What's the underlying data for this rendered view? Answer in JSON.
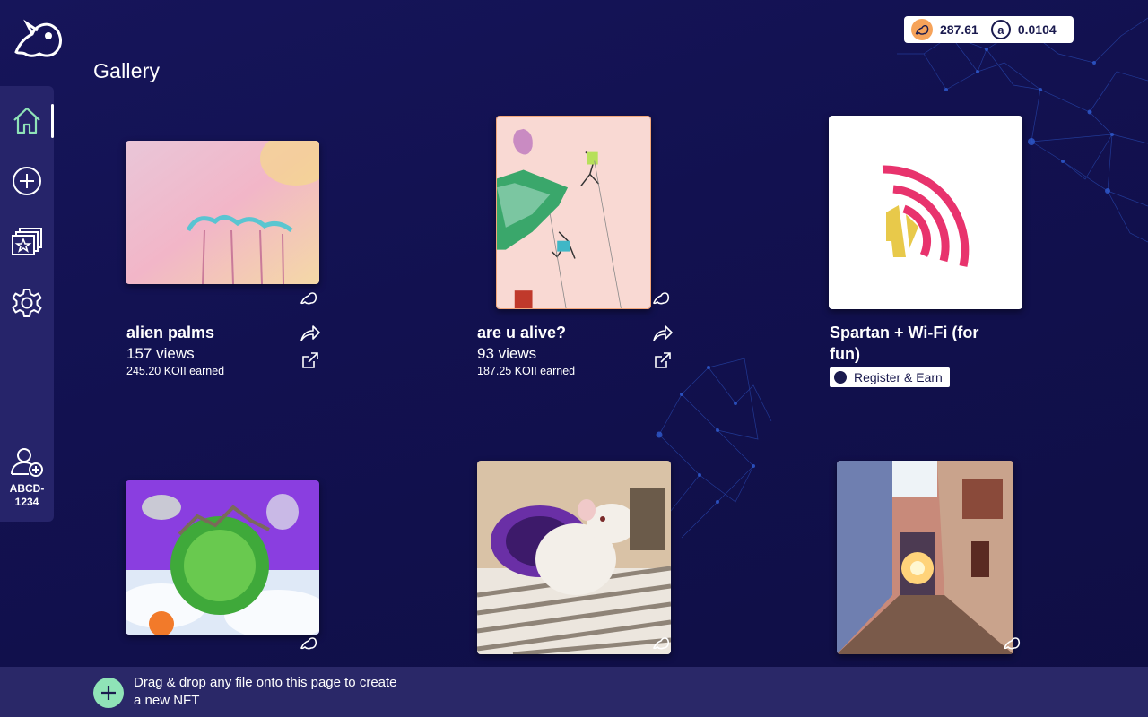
{
  "app": {
    "logo_icon": "koii-logo-icon"
  },
  "balance": {
    "koii_value": "287.61",
    "ar_symbol": "a",
    "ar_value": "0.0104"
  },
  "page": {
    "title": "Gallery"
  },
  "sidebar": {
    "items": [
      {
        "name": "home",
        "icon": "home-icon",
        "active": true
      },
      {
        "name": "create",
        "icon": "plus-circle-icon"
      },
      {
        "name": "collections",
        "icon": "collection-star-icon"
      },
      {
        "name": "settings",
        "icon": "gear-icon"
      }
    ],
    "account": {
      "icon": "add-user-icon",
      "id": "ABCD-\n1234"
    }
  },
  "gallery": {
    "items": [
      {
        "title": "alien palms",
        "views": "157 views",
        "earned": "245.20 KOII earned"
      },
      {
        "title": "are u alive?",
        "views": "93 views",
        "earned": "187.25 KOII earned"
      },
      {
        "title": "Spartan + Wi-Fi (for fun)",
        "register_label": "Register & Earn"
      },
      {
        "title": ""
      },
      {
        "title": ""
      },
      {
        "title": ""
      }
    ]
  },
  "footer": {
    "text": "Drag & drop any file onto this page to create a new NFT"
  },
  "colors": {
    "accent_green": "#8fe3b7",
    "background": "#121150",
    "sidebar": "#26246a",
    "koii_orange": "#f6a35a"
  }
}
